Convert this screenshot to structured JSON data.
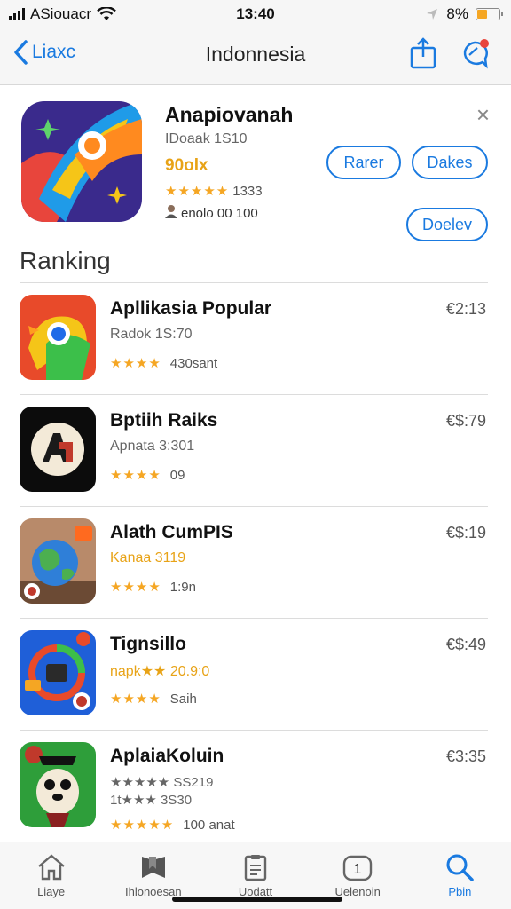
{
  "status": {
    "carrier": "ASiouacr",
    "time": "13:40",
    "battery": "8%",
    "battery_level": 0.45
  },
  "nav": {
    "back_label": "Liaxc",
    "title": "Indonnesia"
  },
  "featured": {
    "title": "Anapiovanah",
    "subtitle": "IDoaak 1S10",
    "price": "90olx",
    "stars": "★★★★★",
    "rating_text": "1333",
    "meta_text": "enolo 00 100",
    "button_1": "Rarer",
    "button_2": "Dakes",
    "button_3": "Doelev",
    "close": "×"
  },
  "ranking": {
    "title": "Ranking",
    "items": [
      {
        "name": "Apllikasia Popular",
        "sub": "Radok 1S:70",
        "stars": "★★★★",
        "rating_text": "430sant",
        "price": "€2:13"
      },
      {
        "name": "Bptiih Raiks",
        "sub": "Apnata 3:301",
        "stars": "★★★★",
        "rating_text": "09",
        "price": "€$:79"
      },
      {
        "name": "Alath CumPIS",
        "sub": "Kanaa 3119",
        "stars": "★★★★",
        "rating_text": "1:9n",
        "price": "€$:19"
      },
      {
        "name": "Tignsillo",
        "sub": "napk★★ 20.9:0",
        "stars": "★★★★",
        "rating_text": "Saih",
        "price": "€$:49"
      },
      {
        "name": "AplaiaKoluin",
        "sub": "★★★★★ SS219",
        "sub2": "1t★★★ 3S30",
        "stars": "★★★★★",
        "rating_text": "100 anat",
        "price": "€3:35"
      }
    ]
  },
  "tabs": [
    {
      "label": "Liaye",
      "icon": "house-icon"
    },
    {
      "label": "Ihlonoesan",
      "icon": "bookmark-stack-icon"
    },
    {
      "label": "Uodatt",
      "icon": "clipboard-icon"
    },
    {
      "label": "Uelenoin",
      "icon": "badge-1-icon",
      "badge": "1"
    },
    {
      "label": "Pbin",
      "icon": "search-icon"
    }
  ],
  "colors": {
    "accent": "#1a7ae0",
    "star": "#f5a623"
  }
}
